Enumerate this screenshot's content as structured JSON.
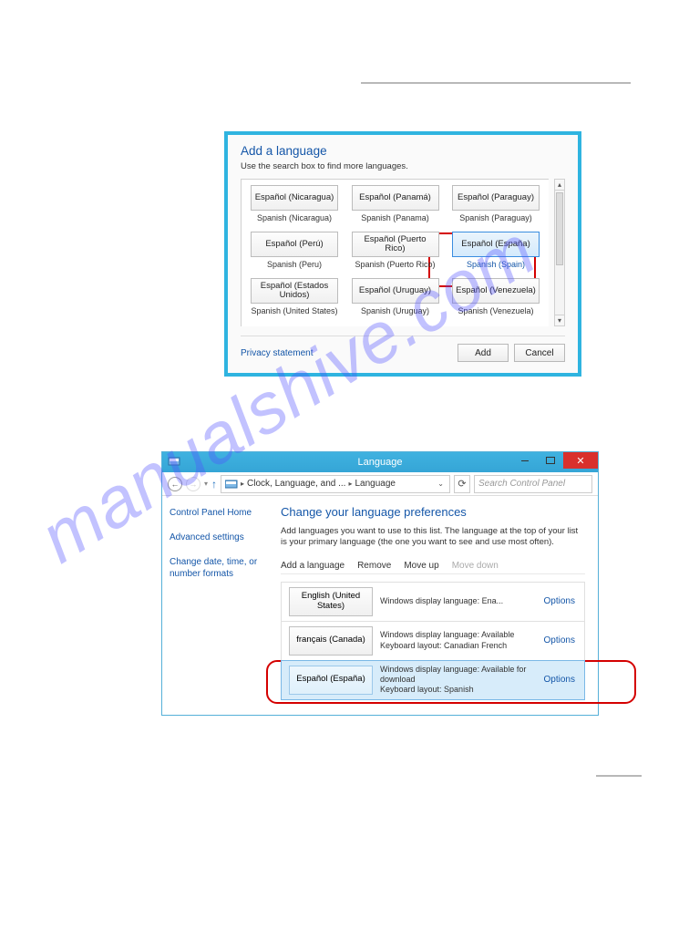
{
  "watermark": "manualshive.com",
  "dialog1": {
    "title": "Add a language",
    "sub": "Use the search box to find more languages.",
    "tiles": [
      [
        {
          "name": "Español (Nicaragua)",
          "label": "Spanish (Nicaragua)"
        },
        {
          "name": "Español (Panamá)",
          "label": "Spanish (Panama)"
        },
        {
          "name": "Español (Paraguay)",
          "label": "Spanish (Paraguay)"
        }
      ],
      [
        {
          "name": "Español (Perú)",
          "label": "Spanish (Peru)"
        },
        {
          "name": "Español (Puerto Rico)",
          "label": "Spanish (Puerto Rico)"
        },
        {
          "name": "Español (España)",
          "label": "Spanish (Spain)",
          "selected": true
        }
      ],
      [
        {
          "name": "Español (Estados Unidos)",
          "label": "Spanish (United States)"
        },
        {
          "name": "Español (Uruguay)",
          "label": "Spanish (Uruguay)"
        },
        {
          "name": "Español (Venezuela)",
          "label": "Spanish (Venezuela)"
        }
      ]
    ],
    "privacy": "Privacy statement",
    "add": "Add",
    "cancel": "Cancel"
  },
  "dialog2": {
    "title": "Language",
    "breadcrumb": {
      "seg1": "Clock, Language, and ...",
      "seg2": "Language"
    },
    "search_placeholder": "Search Control Panel",
    "sidebar": {
      "home": "Control Panel Home",
      "adv": "Advanced settings",
      "clock": "Change date, time, or number formats"
    },
    "main": {
      "heading": "Change your language preferences",
      "desc": "Add languages you want to use to this list. The language at the top of your list is your primary language (the one you want to see and use most often).",
      "act_add": "Add a language",
      "act_remove": "Remove",
      "act_up": "Move up",
      "act_down": "Move down",
      "rows": [
        {
          "box": "English (United States)",
          "desc": "Windows display language: Ena...",
          "opt": "Options"
        },
        {
          "box": "français (Canada)",
          "desc": "Windows display language: Available\nKeyboard layout: Canadian French",
          "opt": "Options"
        },
        {
          "box": "Español (España)",
          "desc": "Windows display language: Available for download\nKeyboard layout: Spanish",
          "opt": "Options",
          "selected": true
        }
      ]
    }
  }
}
